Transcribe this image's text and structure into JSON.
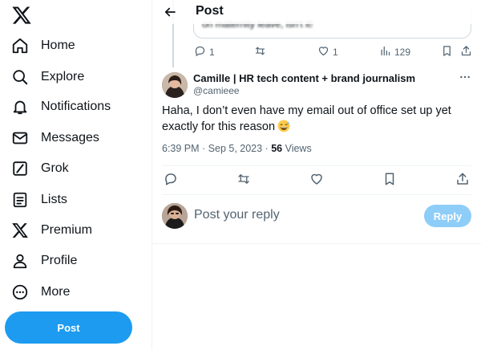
{
  "sidebar": {
    "logo_icon": "x-logo-icon",
    "items": [
      {
        "label": "Home",
        "icon": "home-icon"
      },
      {
        "label": "Explore",
        "icon": "search-icon"
      },
      {
        "label": "Notifications",
        "icon": "bell-icon"
      },
      {
        "label": "Messages",
        "icon": "envelope-icon"
      },
      {
        "label": "Grok",
        "icon": "grok-icon"
      },
      {
        "label": "Lists",
        "icon": "list-icon"
      },
      {
        "label": "Premium",
        "icon": "x-logo-icon"
      },
      {
        "label": "Profile",
        "icon": "person-icon"
      },
      {
        "label": "More",
        "icon": "more-circle-icon"
      }
    ],
    "post_button": "Post"
  },
  "header": {
    "title": "Post",
    "back_icon": "arrow-left-icon"
  },
  "quoted_post": {
    "partial_text": "on maternity leave, isn't it!"
  },
  "parent_actions": {
    "replies": "1",
    "likes": "1",
    "views": "129"
  },
  "post": {
    "author_name": "Camille | HR tech content + brand journalism",
    "author_handle": "@camieee",
    "text": "Haha, I don’t even have my email out of office set up yet exactly for this reason",
    "emoji": "grinning-sweat-emoji",
    "time": "6:39 PM · Sep 5, 2023 · ",
    "views_count": "56",
    "views_label": " Views"
  },
  "reply": {
    "placeholder": "Post your reply",
    "button": "Reply"
  },
  "colors": {
    "accent": "#1d9bf0",
    "accent_disabled": "#8ecdf8",
    "text": "#0f1419",
    "muted": "#536471",
    "border": "#eff3f4"
  }
}
